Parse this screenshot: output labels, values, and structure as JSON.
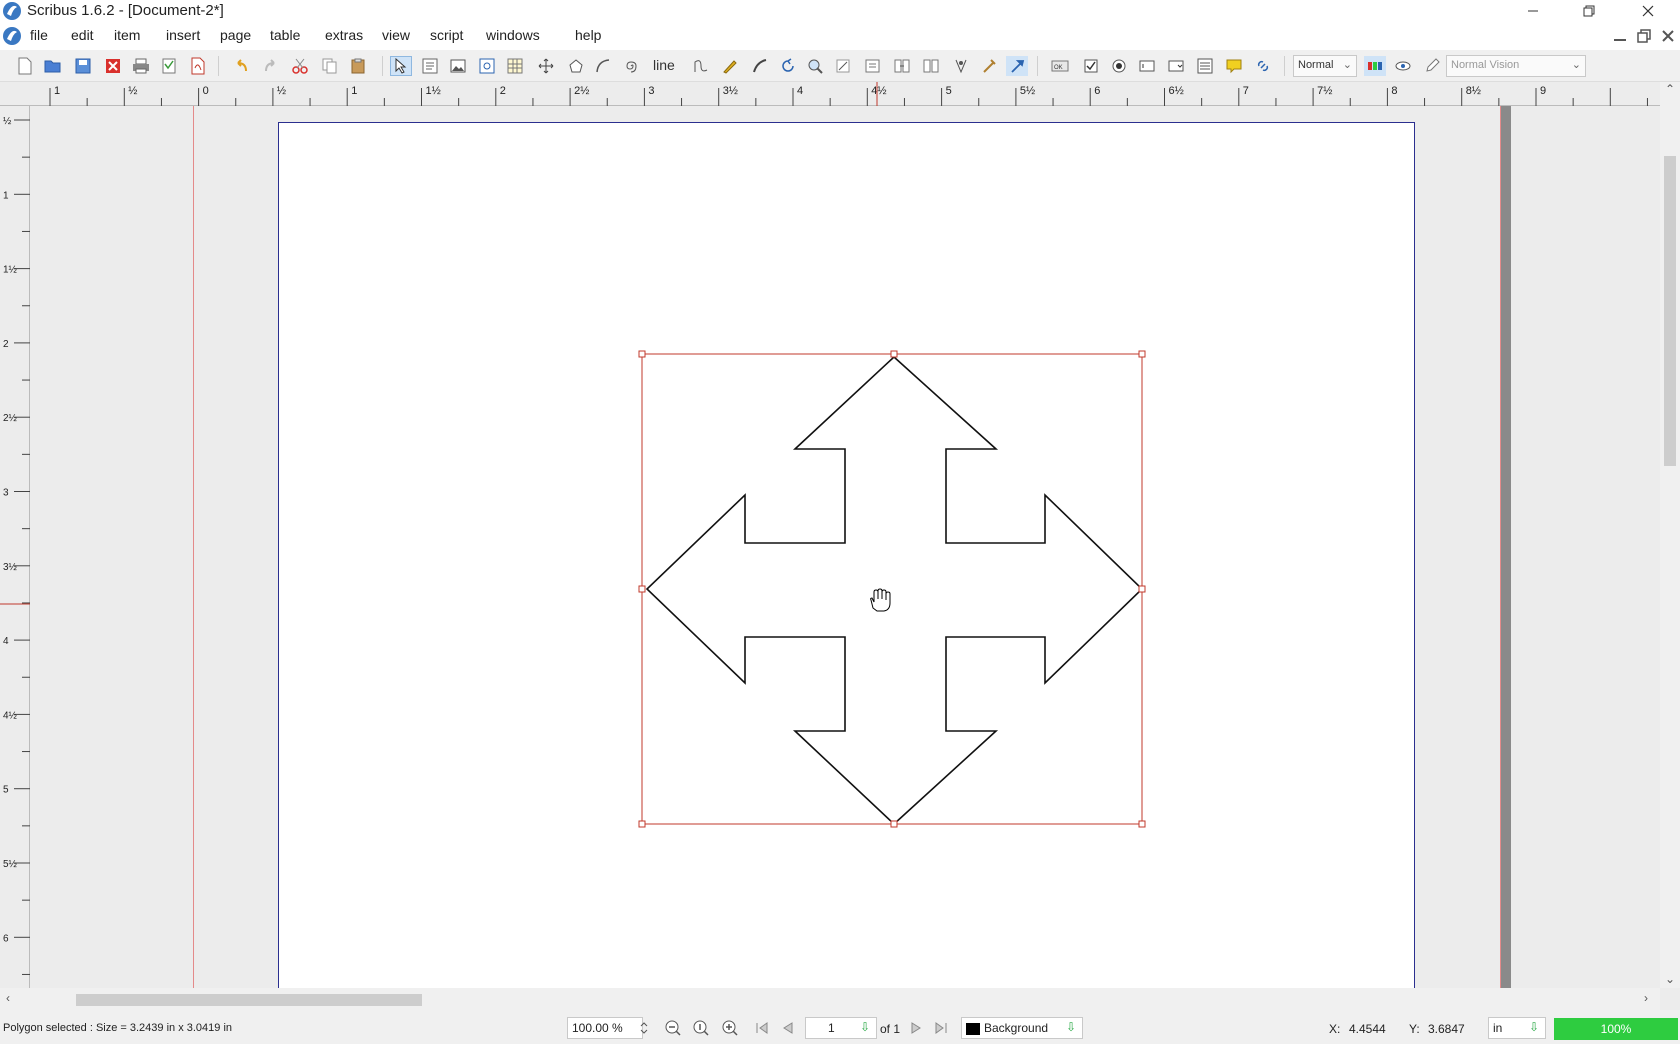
{
  "app": {
    "window_title": "Scribus 1.6.2 - [Document-2*]"
  },
  "menu": {
    "items": [
      "file",
      "edit",
      "item",
      "insert",
      "page",
      "table",
      "extras",
      "view",
      "script",
      "windows",
      "help"
    ]
  },
  "toolbar": {
    "line_label": "line",
    "render_mode": "Normal",
    "vision_mode": "Normal Vision",
    "icons": [
      "new-document-icon",
      "open-icon",
      "save-icon",
      "close-icon",
      "print-icon",
      "preflight-icon",
      "export-pdf-icon",
      "undo-icon",
      "redo-icon",
      "cut-icon",
      "copy-icon",
      "paste-icon",
      "select-icon",
      "text-frame-icon",
      "image-frame-icon",
      "render-frame-icon",
      "table-icon",
      "shape-icon",
      "polygon-icon",
      "arc-icon",
      "spiral-icon",
      "line-icon",
      "bezier-icon",
      "freehand-icon",
      "calligraphic-icon",
      "rotate-icon",
      "zoom-icon",
      "edit-contents-icon",
      "edit-text-icon",
      "link-frames-icon",
      "unlink-frames-icon",
      "measure-icon",
      "copy-properties-icon",
      "eyedropper-icon",
      "pdf-button-icon",
      "pdf-checkbox-icon",
      "pdf-radio-icon",
      "pdf-textfield-icon",
      "pdf-combobox-icon",
      "pdf-listbox-icon",
      "pdf-annotation-icon",
      "pdf-link-icon"
    ]
  },
  "rulers": {
    "horizontal_labels": [
      "1",
      "½",
      "0",
      "½",
      "1",
      "1½",
      "2",
      "2½",
      "3",
      "3½",
      "4",
      "4½",
      "5",
      "5½",
      "6",
      "6½",
      "7",
      "7½",
      "8",
      "8½",
      "9"
    ],
    "vertical_labels": [
      "½",
      "1",
      "1½",
      "2",
      "2½",
      "3",
      "3½",
      "4",
      "4½",
      "5",
      "5½",
      "6"
    ]
  },
  "status": {
    "message": "Polygon selected : Size = 3.2439 in x 3.0419 in",
    "zoom_value": "100.00 %",
    "page_number": "1",
    "page_of": "of 1",
    "layer": "Background",
    "x_label": "X:",
    "x_value": "4.4544",
    "y_label": "Y:",
    "y_value": "3.6847",
    "unit": "in",
    "zoom_percent": "100%"
  },
  "colors": {
    "accent_green": "#2ecc40",
    "selection_red": "#c0392b",
    "page_border": "#2b2f8f"
  }
}
